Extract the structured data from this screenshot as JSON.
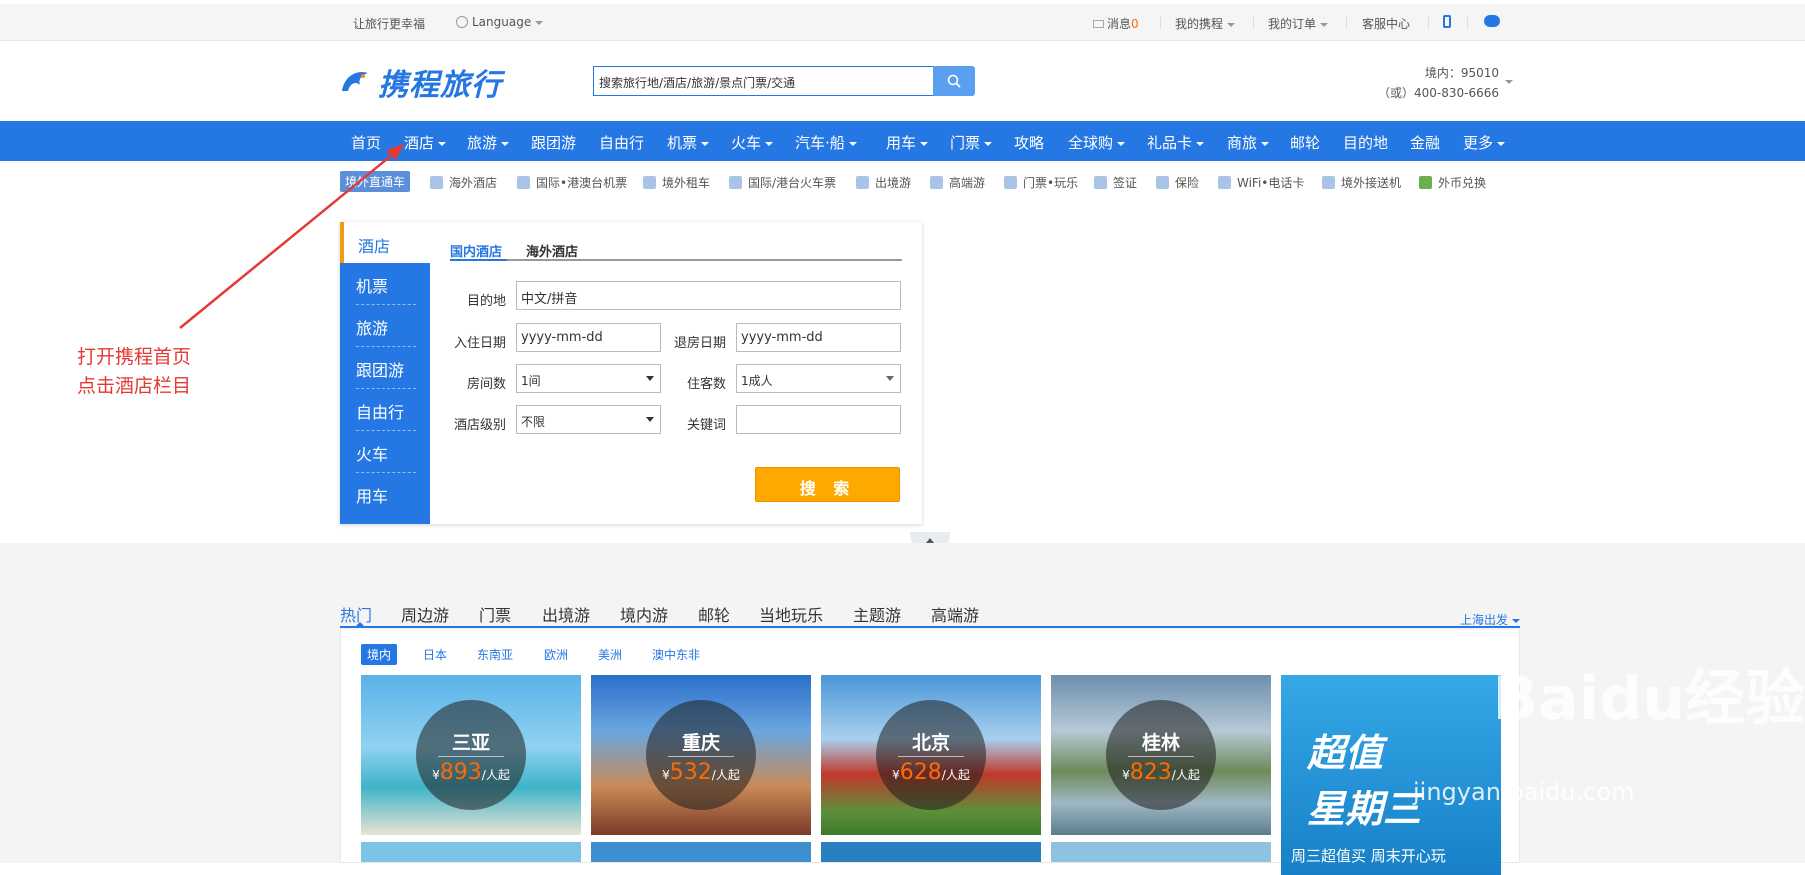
{
  "topbar": {
    "slogan": "让旅行更幸福",
    "language": "Language",
    "messages": "消息",
    "messages_count": "0",
    "my_trips": "我的携程",
    "my_orders": "我的订单",
    "service": "客服中心"
  },
  "header": {
    "logo_text": "携程旅行",
    "search_placeholder": "搜索旅行地/酒店/旅游/景点门票/交通",
    "hotline_domestic": "境内：95010",
    "hotline_alt": "（或）400-830-6666"
  },
  "nav": {
    "items": [
      "首页",
      "酒店",
      "旅游",
      "跟团游",
      "自由行",
      "机票",
      "火车",
      "汽车·船",
      "用车",
      "门票",
      "攻略",
      "全球购",
      "礼品卡",
      "商旅",
      "邮轮",
      "目的地",
      "金融",
      "更多"
    ]
  },
  "quick": {
    "tag": "境外直通车",
    "items": [
      "海外酒店",
      "国际•港澳台机票",
      "境外租车",
      "国际/港台火车票",
      "出境游",
      "高端游",
      "门票•玩乐",
      "签证",
      "保险",
      "WiFi•电话卡",
      "境外接送机",
      "外币兑换"
    ]
  },
  "booking": {
    "side_items": [
      "酒店",
      "机票",
      "旅游",
      "跟团游",
      "自由行",
      "火车",
      "用车"
    ],
    "tabs": [
      "国内酒店",
      "海外酒店"
    ],
    "destination_label": "目的地",
    "destination_value": "中文/拼音",
    "checkin_label": "入住日期",
    "checkin_value": "yyyy-mm-dd",
    "checkout_label": "退房日期",
    "checkout_value": "yyyy-mm-dd",
    "rooms_label": "房间数",
    "rooms_value": "1间",
    "guests_label": "住客数",
    "guests_value": "1成人",
    "level_label": "酒店级别",
    "level_value": "不限",
    "keyword_label": "关键词",
    "keyword_value": "",
    "search_button": "搜 索"
  },
  "content": {
    "tabs": [
      "热门",
      "周边游",
      "门票",
      "出境游",
      "境内游",
      "邮轮",
      "当地玩乐",
      "主题游",
      "高端游"
    ],
    "departure": "上海出发",
    "regions": [
      "境内",
      "日本",
      "东南亚",
      "欧洲",
      "美洲",
      "澳中东非"
    ],
    "cards": [
      {
        "city": "三亚",
        "currency": "¥",
        "price": "893",
        "unit": "/人起"
      },
      {
        "city": "重庆",
        "currency": "¥",
        "price": "532",
        "unit": "/人起"
      },
      {
        "city": "北京",
        "currency": "¥",
        "price": "628",
        "unit": "/人起"
      },
      {
        "city": "桂林",
        "currency": "¥",
        "price": "823",
        "unit": "/人起"
      }
    ],
    "promo_big_1": "超值",
    "promo_big_2": "星期三",
    "promo_small": "周三超值买 周末开心玩"
  },
  "annotation": {
    "line1": "打开携程首页",
    "line2": "点击酒店栏目"
  },
  "watermark": {
    "brand": "Baidu经验",
    "url": "jingyan.baidu.com"
  },
  "colors": {
    "brand_blue": "#2577e3",
    "orange_button": "#ffa800",
    "annotation_red": "#e53935"
  }
}
